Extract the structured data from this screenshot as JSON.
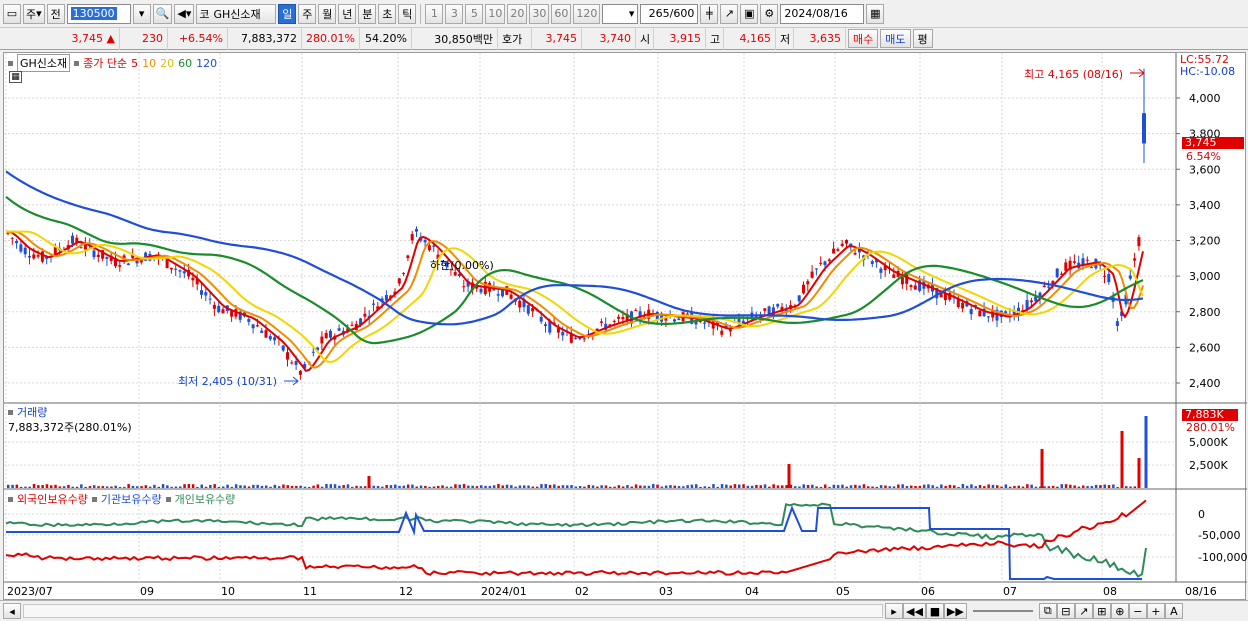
{
  "toolbar": {
    "market_label": "주",
    "prev_label": "전",
    "stock_code": "130500",
    "stock_name": "GH신소재",
    "periods": [
      "일",
      "주",
      "월",
      "년",
      "분",
      "초",
      "틱"
    ],
    "active_period": "일",
    "intervals": [
      "1",
      "3",
      "5",
      "10",
      "20",
      "30",
      "60",
      "120"
    ],
    "count_value": "265",
    "count_max": "/600",
    "date_value": "2024/08/16"
  },
  "info": {
    "price": "3,745",
    "arrow": "▲",
    "change": "230",
    "change_pct": "+6.54%",
    "volume": "7,883,372",
    "volume_ratio": "280.01%",
    "turnover_pct": "54.20%",
    "amount": "30,850백만",
    "quote_label": "호가",
    "ask": "3,745",
    "bid": "3,740",
    "open_label": "시",
    "open": "3,915",
    "high_label": "고",
    "high": "4,165",
    "low_label": "저",
    "low": "3,635",
    "buy_label": "매수",
    "sell_label": "매도",
    "eval_label": "평"
  },
  "price_pane": {
    "stock_tag": "GH신소재",
    "ma_label": "종가 단순",
    "ma_periods": [
      "5",
      "10",
      "20",
      "60",
      "120"
    ],
    "ma_colors": [
      "#e00000",
      "#f08c00",
      "#f2d600",
      "#1a8c2a",
      "#1f4fd8"
    ],
    "high_annotation": "최고 4,165 (08/16)",
    "low_annotation": "최저 2,405 (10/31)",
    "mid_annotation": "하한(0.00%)",
    "lc_label": "LC:55.72",
    "hc_label": "HC:-10.08",
    "current_price_tag": "3,745",
    "current_pct_tag": "6.54%",
    "y_ticks": [
      "4,000",
      "3,800",
      "3,600",
      "3,400",
      "3,200",
      "3,000",
      "2,800",
      "2,600",
      "2,400"
    ]
  },
  "volume_pane": {
    "title": "거래량",
    "value_text": "7,883,372주(280.01%)",
    "tag_value": "7,883K",
    "tag_pct": "280.01%",
    "y_ticks": [
      "5,000K",
      "2,500K"
    ]
  },
  "holdings_pane": {
    "legend": [
      "외국인보유수량",
      "기관보유수량",
      "개인보유수량"
    ],
    "legend_colors": [
      "#e00000",
      "#1f4fd8",
      "#2e8b57"
    ],
    "y_ticks": [
      "0",
      "-50,000",
      "-100,000"
    ]
  },
  "x_axis": {
    "labels": [
      "2023/07",
      "09",
      "10",
      "11",
      "12",
      "2024/01",
      "02",
      "03",
      "04",
      "05",
      "06",
      "07",
      "08",
      "08/16"
    ]
  },
  "colors": {
    "up": "#e00000",
    "down": "#1f4fd8",
    "accent": "#2b6fd6"
  }
}
